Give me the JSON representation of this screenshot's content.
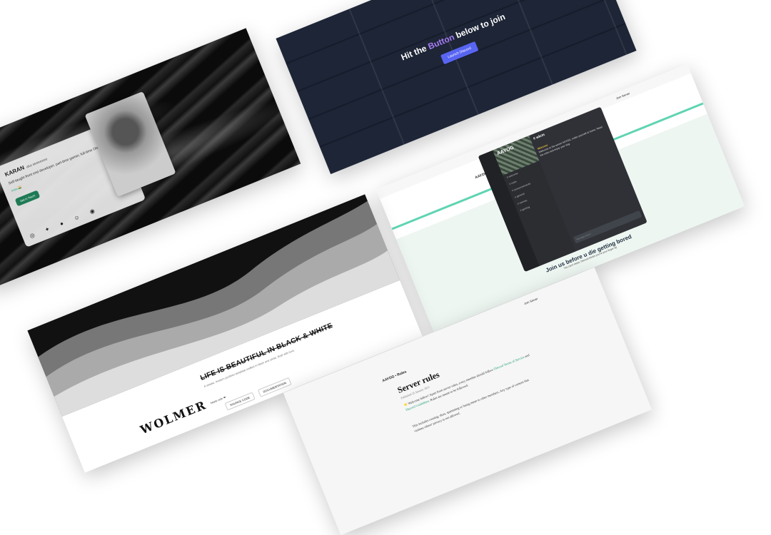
{
  "portfolio": {
    "name": "KARAN",
    "name_suffix": "aka seeeeeee",
    "bio": "Self-taught front end developer, part-time gamer, full-time Otaku.",
    "location": "India 🇮🇳",
    "cta": "Get in Touch",
    "socials": [
      "instagram-icon",
      "twitter-icon",
      "github-icon",
      "snapchat-icon",
      "discord-icon"
    ]
  },
  "join_banner": {
    "text_before": "Hit the ",
    "text_accent": "Button",
    "text_after": " below to join",
    "button": "Launch Discord",
    "accent_color": "#a67cf5",
    "button_color": "#5865f2"
  },
  "rules_landing": {
    "join_link": "Join Server",
    "brand": "AAYOG • Rules",
    "server_banner": "AAYOG",
    "channel_title": "# wlcm",
    "channels": [
      "# welcome",
      "# rules",
      "# announcements",
      "# general",
      "# memes",
      "# gaming"
    ],
    "welcome_name": "Welcome",
    "message": "Welcome to the server AAYOG, make yourself at home. Read the rules and enjoy your stay.",
    "input_placeholder": "Message #wlcm",
    "cta_title": "Join us before u die getting bored",
    "cta_sub": "You can't resist, Discord thinks you're your finger tip"
  },
  "wolmer": {
    "tagline": "LIFE IS BEAUTIFUL IN BLACK & WHITE",
    "sub": "A simple, modern portfolio template crafted in black and white. Built with love.",
    "made_with": "Made with ❤",
    "source_code": "SOURCE CODE",
    "documentation": "DOCUMENTATION",
    "logo": "WOLMER"
  },
  "rules_page": {
    "join_link": "Join Server",
    "brand": "AAYOG • Rules",
    "title": "Server rules",
    "date": "Published 25 January 2021",
    "intro_prefix": "⭐ Welcome fellow! Apart from server rules, every member should follow ",
    "link1": "Discord Terms of Service",
    "intro_mid": " and ",
    "link2": "Discord Guidelines",
    "intro_suffix": ". Rules are meant to be followed.",
    "para2": "This includes cussing, slurs, spamming or being mean to other members. Any type of content that violates others' privacy is not allowed."
  }
}
